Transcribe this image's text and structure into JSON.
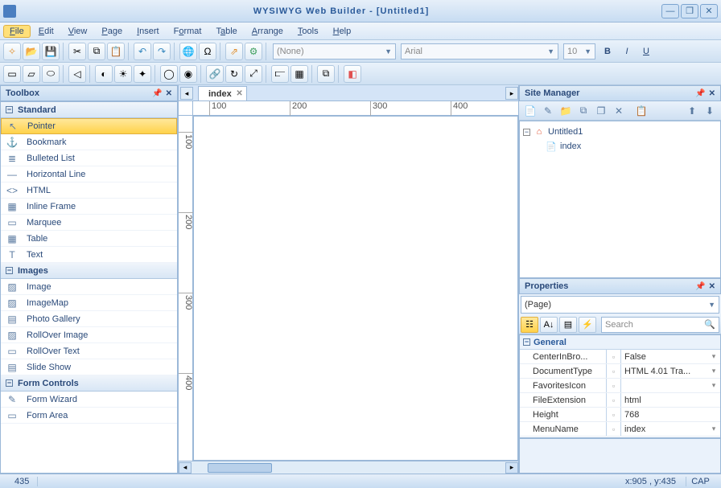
{
  "title": "WYSIWYG Web Builder - [Untitled1]",
  "menus": [
    "File",
    "Edit",
    "View",
    "Page",
    "Insert",
    "Format",
    "Table",
    "Arrange",
    "Tools",
    "Help"
  ],
  "toolbar_style": "(None)",
  "toolbar_font": "Arial",
  "toolbar_size": "10",
  "toolbox": {
    "title": "Toolbox",
    "categories": [
      {
        "name": "Standard",
        "items": [
          {
            "icon": "↖",
            "label": "Pointer",
            "selected": true
          },
          {
            "icon": "⚓",
            "label": "Bookmark"
          },
          {
            "icon": "≣",
            "label": "Bulleted List"
          },
          {
            "icon": "—",
            "label": "Horizontal Line"
          },
          {
            "icon": "<>",
            "label": "HTML"
          },
          {
            "icon": "▦",
            "label": "Inline Frame"
          },
          {
            "icon": "▭",
            "label": "Marquee"
          },
          {
            "icon": "▦",
            "label": "Table"
          },
          {
            "icon": "T",
            "label": "Text"
          }
        ]
      },
      {
        "name": "Images",
        "items": [
          {
            "icon": "▨",
            "label": "Image"
          },
          {
            "icon": "▨",
            "label": "ImageMap"
          },
          {
            "icon": "▤",
            "label": "Photo Gallery"
          },
          {
            "icon": "▨",
            "label": "RollOver Image"
          },
          {
            "icon": "▭",
            "label": "RollOver Text"
          },
          {
            "icon": "▤",
            "label": "Slide Show"
          }
        ]
      },
      {
        "name": "Form Controls",
        "items": [
          {
            "icon": "✎",
            "label": "Form Wizard"
          },
          {
            "icon": "▭",
            "label": "Form Area"
          }
        ]
      }
    ]
  },
  "tab": "index",
  "ruler_h": [
    "100",
    "200",
    "300",
    "400"
  ],
  "ruler_v": [
    "100",
    "200",
    "300",
    "400"
  ],
  "site": {
    "title": "Site Manager",
    "root": "Untitled1",
    "child": "index"
  },
  "props": {
    "title": "Properties",
    "object": "(Page)",
    "search_ph": "Search",
    "category": "General",
    "rows": [
      {
        "name": "CenterInBro...",
        "val": "False",
        "dd": true
      },
      {
        "name": "DocumentType",
        "val": "HTML 4.01 Tra...",
        "dd": true
      },
      {
        "name": "FavoritesIcon",
        "val": "",
        "dd": true
      },
      {
        "name": "FileExtension",
        "val": "html"
      },
      {
        "name": "Height",
        "val": "768"
      },
      {
        "name": "MenuName",
        "val": "index",
        "dd": true
      }
    ]
  },
  "status": {
    "left": "435",
    "coords": "x:905 , y:435",
    "cap": "CAP"
  }
}
